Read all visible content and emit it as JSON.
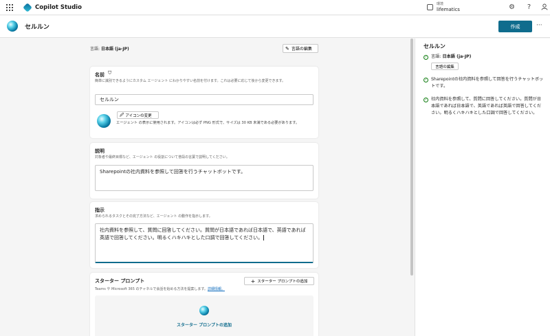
{
  "app": {
    "name": "Copilot Studio",
    "env_label": "環境",
    "env_name": "lifematics",
    "icons": [
      "app-launcher-icon",
      "environment-icon",
      "settings-icon",
      "help-icon",
      "user-icon"
    ]
  },
  "header": {
    "agent_name": "セルルン",
    "create_label": "作成",
    "more_label": "···"
  },
  "language": {
    "prefix": "言語: ",
    "value": "日本語 (ja-JP)",
    "edit_label": "言語の編集"
  },
  "name_card": {
    "title": "名前",
    "description": "簡単に識別できるようにカスタム エージェント にわかりやすい名前を付けます。これは必要に応じて後から変更できます。",
    "value": "セルルン",
    "icon_change_label": "アイコンの変更",
    "icon_note": "エージェント の表示に使用されます。アイコンは必ず PNG 形式で、サイズは 30 KB 未満である必要があります。"
  },
  "description_card": {
    "title": "説明",
    "description": "対象者や最終目標など、エージェント の役割について普段の言葉で説明してください。",
    "value": "Sharepointの社内資料を参照して回答を行うチャットボットです。"
  },
  "instructions_card": {
    "title": "指示",
    "description": "求められるタスクとその完了方法など、エージェント の動作を指示します。",
    "value": "社内資料を参照して、質問に回答してください。質問が日本語であれば日本語で、英語であれば英語で回答してください。明るくハキハキとした口調で回答してください。"
  },
  "starter_card": {
    "title": "スターター プロンプト",
    "add_label": "スターター プロンプトの追加",
    "description": "Teams や Microsoft 365 のチャネルで会話を始める方法を提案します。",
    "link": "詳細情報。",
    "box_label": "スターター プロンプトの追加"
  },
  "side_panel": {
    "title": "セルルン",
    "language_prefix": "言語: ",
    "language_value": "日本語 (ja-JP)",
    "language_edit_label": "言語の編集",
    "description": "Sharepointの社内資料を参照して回答を行うチャットボットです。",
    "instructions": "社内資料を参照して、質問に回答してください。質問が日本語であれば日本語で、英語であれば英語で回答してください。明るくハキハキとした口調で回答してください。"
  },
  "colors": {
    "accent": "#0f6c8d",
    "link": "#0f6cbd",
    "success": "#107c10"
  }
}
